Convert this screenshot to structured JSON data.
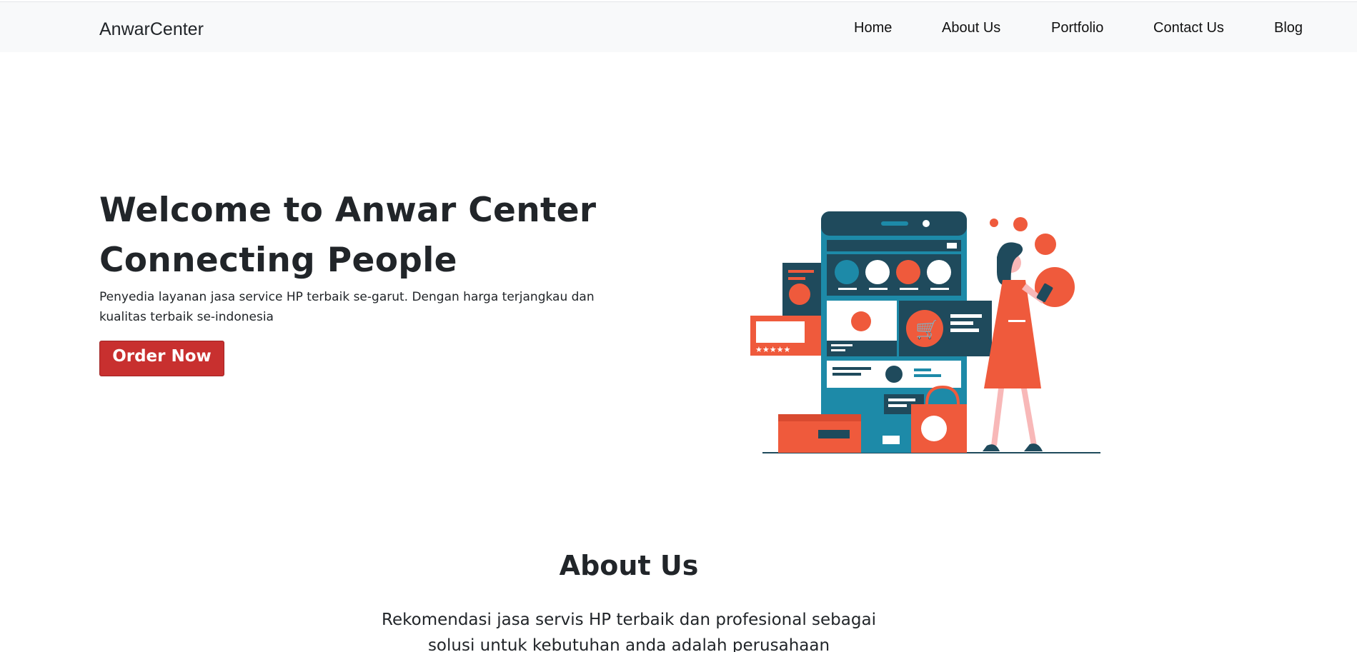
{
  "navbar": {
    "brand": "AnwarCenter",
    "links": [
      "Home",
      "About Us",
      "Portfolio",
      "Contact Us",
      "Blog"
    ]
  },
  "hero": {
    "title_line1": "Welcome to Anwar Center",
    "title_line2": "Connecting People",
    "description": "Penyedia layanan jasa service HP terbaik se-garut. Dengan harga terjangkau dan kualitas terbaik se-indonesia",
    "button_label": "Order Now",
    "button_color": "#c8302f"
  },
  "illustration": {
    "icon": "online-shopping-illustration",
    "colors": {
      "teal": "#1d8aa8",
      "navy": "#1f4a5c",
      "orange": "#ef5a3c",
      "pink": "#f8b8b8"
    }
  },
  "about": {
    "title": "About Us",
    "text": "Rekomendasi jasa servis HP terbaik dan profesional sebagai solusi untuk kebutuhan anda adalah perusahaan AnwarCenter."
  }
}
